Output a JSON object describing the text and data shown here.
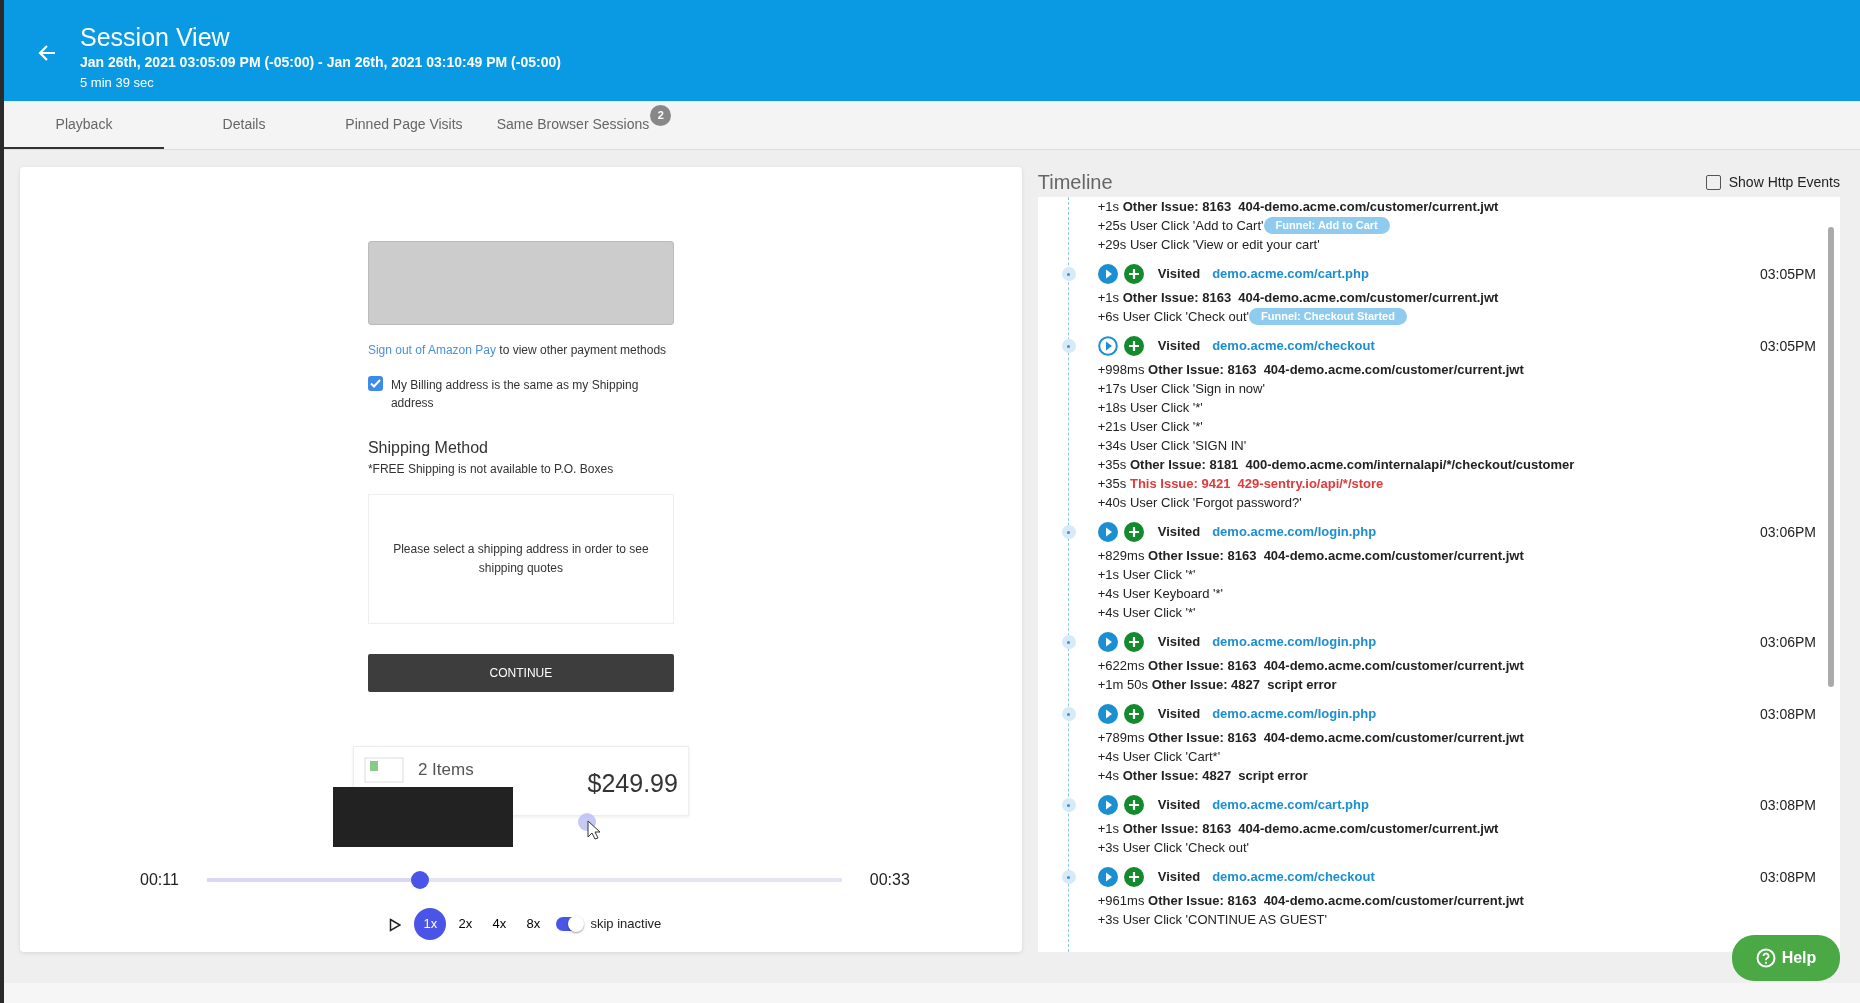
{
  "header": {
    "title": "Session View",
    "range": "Jan 26th, 2021 03:05:09 PM (-05:00) - Jan 26th, 2021 03:10:49 PM (-05:00)",
    "duration": "5 min 39 sec"
  },
  "tabs": [
    {
      "label": "Playback",
      "selected": true
    },
    {
      "label": "Details",
      "selected": false
    },
    {
      "label": "Pinned Page Visits",
      "selected": false
    },
    {
      "label": "Same Browser Sessions",
      "selected": false,
      "badge": "2"
    }
  ],
  "recording": {
    "signout_link": "Sign out of Amazon Pay",
    "signout_text": "to view other payment methods",
    "billing_checkbox": {
      "label": "My Billing address is the same as my Shipping address",
      "checked": true
    },
    "shipping_heading": "Shipping Method",
    "shipping_note": "*FREE Shipping is not available to P.O. Boxes",
    "shipping_message": "Please select a shipping address in order to see shipping quotes",
    "continue_button": "CONTINUE",
    "cart_items": "2 Items",
    "cart_total": "$249.99"
  },
  "player": {
    "elapsed": "00:11",
    "total": "00:33",
    "level": 0.335,
    "speeds": [
      {
        "label": "1x",
        "selected": true
      },
      {
        "label": "2x",
        "selected": false
      },
      {
        "label": "4x",
        "selected": false
      },
      {
        "label": "8x",
        "selected": false
      }
    ],
    "skip_inactive": {
      "label": "skip inactive",
      "on": true
    }
  },
  "timeline": {
    "title": "Timeline",
    "show_http": {
      "label": "Show Http Events",
      "checked": false
    },
    "groups": [
      {
        "events": [
          {
            "offset": "+1s",
            "kind": "issue",
            "label": "Other Issue: 8163",
            "detail": "404-demo.acme.com/customer/current.jwt"
          },
          {
            "offset": "+25s",
            "kind": "action",
            "text": "User Click 'Add to Cart'",
            "funnel": "Funnel: Add to Cart"
          },
          {
            "offset": "+29s",
            "kind": "action",
            "text": "User Click 'View or edit your cart'"
          }
        ]
      },
      {
        "visit": {
          "url": "demo.acme.com/cart.php",
          "time": "03:05PM",
          "label": "Visited",
          "playing": false
        },
        "events": [
          {
            "offset": "+1s",
            "kind": "issue",
            "label": "Other Issue: 8163",
            "detail": "404-demo.acme.com/customer/current.jwt"
          },
          {
            "offset": "+6s",
            "kind": "action",
            "text": "User Click 'Check out'",
            "funnel": "Funnel: Checkout Started"
          }
        ]
      },
      {
        "visit": {
          "url": "demo.acme.com/checkout",
          "time": "03:05PM",
          "label": "Visited",
          "playing": true
        },
        "events": [
          {
            "offset": "+998ms",
            "kind": "issue",
            "label": "Other Issue: 8163",
            "detail": "404-demo.acme.com/customer/current.jwt"
          },
          {
            "offset": "+17s",
            "kind": "action",
            "text": "User Click 'Sign in now'"
          },
          {
            "offset": "+18s",
            "kind": "action",
            "text": "User Click '*'"
          },
          {
            "offset": "+21s",
            "kind": "action",
            "text": "User Click '*'"
          },
          {
            "offset": "+34s",
            "kind": "action",
            "text": "User Click 'SIGN IN'"
          },
          {
            "offset": "+35s",
            "kind": "issue",
            "label": "Other Issue: 8181",
            "detail": "400-demo.acme.com/internalapi/*/checkout/customer"
          },
          {
            "offset": "+35s",
            "kind": "this_issue",
            "label": "This Issue: 9421",
            "detail": "429-sentry.io/api/*/store"
          },
          {
            "offset": "+40s",
            "kind": "action",
            "text": "User Click 'Forgot password?'"
          }
        ]
      },
      {
        "visit": {
          "url": "demo.acme.com/login.php",
          "time": "03:06PM",
          "label": "Visited",
          "playing": false
        },
        "events": [
          {
            "offset": "+829ms",
            "kind": "issue",
            "label": "Other Issue: 8163",
            "detail": "404-demo.acme.com/customer/current.jwt"
          },
          {
            "offset": "+1s",
            "kind": "action",
            "text": "User Click '*'"
          },
          {
            "offset": "+4s",
            "kind": "action",
            "text": "User Keyboard '*'"
          },
          {
            "offset": "+4s",
            "kind": "action",
            "text": "User Click '*'"
          }
        ]
      },
      {
        "visit": {
          "url": "demo.acme.com/login.php",
          "time": "03:06PM",
          "label": "Visited",
          "playing": false
        },
        "events": [
          {
            "offset": "+622ms",
            "kind": "issue",
            "label": "Other Issue: 8163",
            "detail": "404-demo.acme.com/customer/current.jwt"
          },
          {
            "offset": "+1m 50s",
            "kind": "issue",
            "label": "Other Issue: 4827",
            "detail": "script error"
          }
        ]
      },
      {
        "visit": {
          "url": "demo.acme.com/login.php",
          "time": "03:08PM",
          "label": "Visited",
          "playing": false
        },
        "events": [
          {
            "offset": "+789ms",
            "kind": "issue",
            "label": "Other Issue: 8163",
            "detail": "404-demo.acme.com/customer/current.jwt"
          },
          {
            "offset": "+4s",
            "kind": "action",
            "text": "User Click 'Cart*'"
          },
          {
            "offset": "+4s",
            "kind": "issue",
            "label": "Other Issue: 4827",
            "detail": "script error"
          }
        ]
      },
      {
        "visit": {
          "url": "demo.acme.com/cart.php",
          "time": "03:08PM",
          "label": "Visited",
          "playing": false
        },
        "events": [
          {
            "offset": "+1s",
            "kind": "issue",
            "label": "Other Issue: 8163",
            "detail": "404-demo.acme.com/customer/current.jwt"
          },
          {
            "offset": "+3s",
            "kind": "action",
            "text": "User Click 'Check out'"
          }
        ]
      },
      {
        "visit": {
          "url": "demo.acme.com/checkout",
          "time": "03:08PM",
          "label": "Visited",
          "playing": false
        },
        "events": [
          {
            "offset": "+961ms",
            "kind": "issue",
            "label": "Other Issue: 8163",
            "detail": "404-demo.acme.com/customer/current.jwt"
          },
          {
            "offset": "+3s",
            "kind": "action",
            "text": "User Click 'CONTINUE AS GUEST'"
          }
        ]
      }
    ]
  },
  "help_button": "Help"
}
